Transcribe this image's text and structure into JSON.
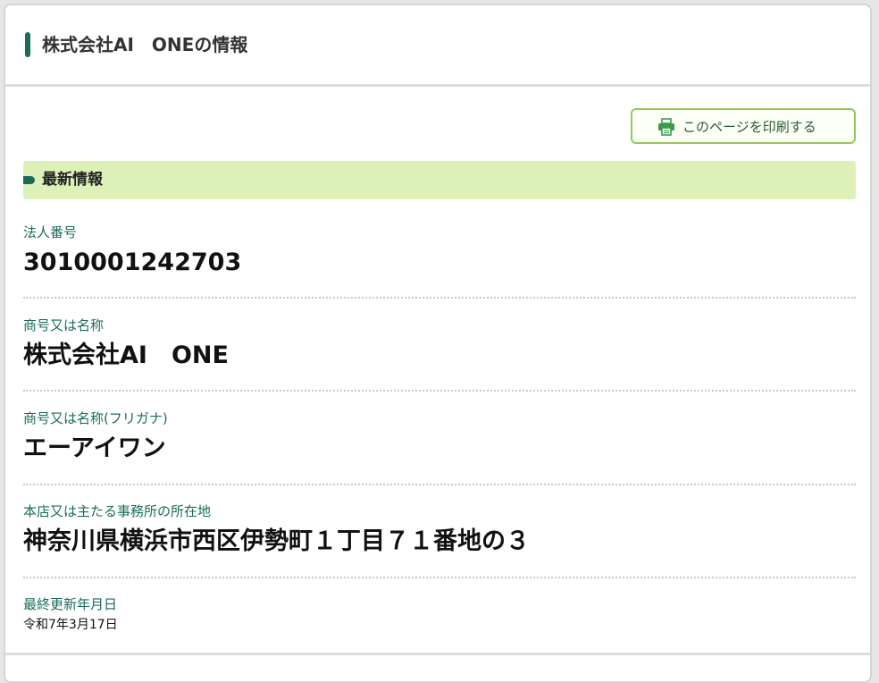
{
  "header": {
    "title": "株式会社AI　ONEの情報"
  },
  "actions": {
    "print_label": "このページを印刷する",
    "print_icon": "printer-icon"
  },
  "section": {
    "title": "最新情報"
  },
  "fields": [
    {
      "label": "法人番号",
      "value": "3010001242703"
    },
    {
      "label": "商号又は名称",
      "value": "株式会社AI　ONE"
    },
    {
      "label": "商号又は名称(フリガナ)",
      "value": "エーアイワン"
    },
    {
      "label": "本店又は主たる事務所の所在地",
      "value": "神奈川県横浜市西区伊勢町１丁目７１番地の３"
    },
    {
      "label": "最終更新年月日",
      "value": "令和7年3月17日"
    }
  ],
  "colors": {
    "accent": "#1a6b5a",
    "section_band": "#ddf0b8",
    "button_border": "#92c95a"
  }
}
